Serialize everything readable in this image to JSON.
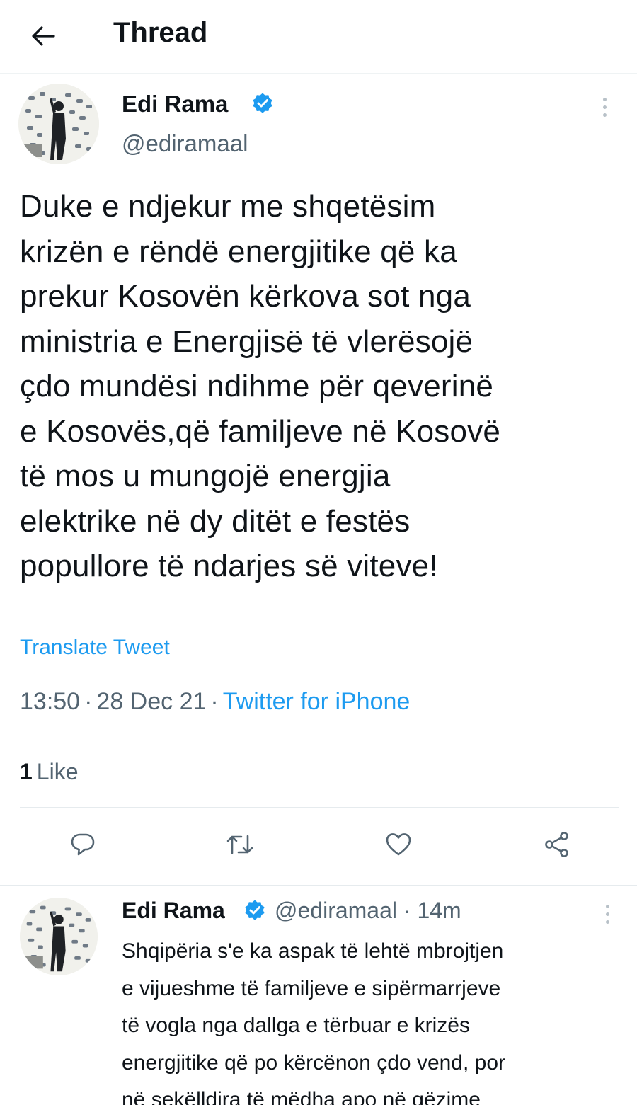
{
  "header": {
    "back_icon": "arrow-left-icon",
    "title": "Thread"
  },
  "main_tweet": {
    "author_name": "Edi Rama",
    "verified_icon": "verified-badge-icon",
    "handle": "@ediramaal",
    "text": "Duke e ndjekur me shqetësim\nkrizën e rëndë energjitike që ka\nprekur Kosovën kërkova sot nga\nministria e Energjisë të vlerësojë\nçdo mundësi ndihme për qeverinë\ne Kosovës,që familjeve në Kosovë\ntë mos u mungojë energjia\nelektrike në dy ditët e festës\npopullore të ndarjes së viteve!",
    "translate_label": "Translate Tweet",
    "time": "13:50",
    "date": "28 Dec 21",
    "separator": "·",
    "source": "Twitter for iPhone",
    "likes_count": "1",
    "likes_label": "Like",
    "actions": [
      "reply-icon",
      "retweet-icon",
      "like-icon",
      "share-icon"
    ]
  },
  "reply_tweet": {
    "author_name": "Edi Rama",
    "handle_and_time": "@ediramaal · 14m",
    "text": "Shqipëria s'e ka aspak të lehtë mbrojtjen\ne vijueshme të familjeve e sipërmarrjeve\ntë vogla nga dallga e tërbuar e krizës\nenergjitike që po kërcënon çdo vend, por\nnë sekëlldira të mëdha apo në gëzime"
  },
  "colors": {
    "text": "#0f1419",
    "secondary": "#536471",
    "accent": "#1d9bf0",
    "divider": "#e6ebee"
  }
}
